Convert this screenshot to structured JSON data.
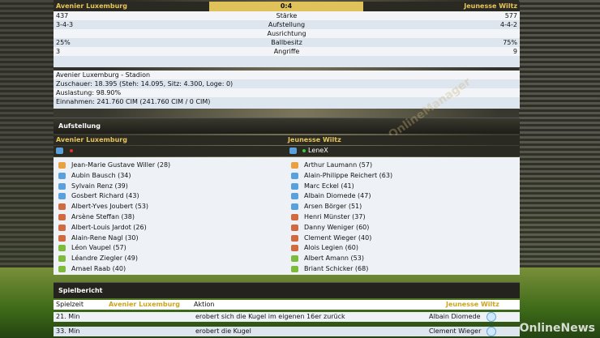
{
  "match": {
    "home": "Avenier Luxemburg",
    "away": "Jeunesse Wiltz",
    "score": "0:4"
  },
  "stats": [
    {
      "home": "437",
      "label": "Stärke",
      "away": "577"
    },
    {
      "home": "3-4-3",
      "label": "Aufstellung",
      "away": "4-4-2"
    },
    {
      "home": "",
      "label": "Ausrichtung",
      "away": ""
    },
    {
      "home": "25%",
      "label": "Ballbesitz",
      "away": "75%"
    },
    {
      "home": "3",
      "label": "Angriffe",
      "away": "9"
    }
  ],
  "info": {
    "stadium": "Avenier Luxemburg - Stadion",
    "spectators": "Zuschauer: 18.395 (Steh: 14.095, Sitz: 4.300, Loge: 0)",
    "utilization": "Auslastung: 98.90%",
    "income": "Einnahmen: 241.760 CIM (241.760 CIM / 0 CIM)"
  },
  "lineup": {
    "title": "Aufstellung",
    "home_team": "Avenier Luxemburg",
    "away_team": "Jeunesse Wiltz",
    "away_manager": "LeneX",
    "home_players": [
      {
        "name": "Jean-Marie Gustave Willer (28)",
        "pos": "gk"
      },
      {
        "name": "Aubin Bausch (34)",
        "pos": "df"
      },
      {
        "name": "Sylvain Renz (39)",
        "pos": "df"
      },
      {
        "name": "Gosbert Richard (43)",
        "pos": "df"
      },
      {
        "name": "Albert-Yves Joubert (53)",
        "pos": "mf"
      },
      {
        "name": "Arsène Steffan (38)",
        "pos": "mf"
      },
      {
        "name": "Albert-Louis Jardot (26)",
        "pos": "mf"
      },
      {
        "name": "Alain-Rene Nagl (30)",
        "pos": "mf"
      },
      {
        "name": "Léon Vaupel (57)",
        "pos": "fw"
      },
      {
        "name": "Léandre Ziegler (49)",
        "pos": "fw"
      },
      {
        "name": "Amael Raab (40)",
        "pos": "fw"
      }
    ],
    "away_players": [
      {
        "name": "Arthur Laumann (57)",
        "pos": "gk"
      },
      {
        "name": "Alain-Philippe Reichert (63)",
        "pos": "df"
      },
      {
        "name": "Marc Eckel (41)",
        "pos": "df"
      },
      {
        "name": "Albain Diomede (47)",
        "pos": "df"
      },
      {
        "name": "Arsen Börger (51)",
        "pos": "df"
      },
      {
        "name": "Henri Münster (37)",
        "pos": "mf"
      },
      {
        "name": "Danny Weniger (60)",
        "pos": "mf"
      },
      {
        "name": "Clement Wieger (40)",
        "pos": "mf"
      },
      {
        "name": "Alois Legien (60)",
        "pos": "mf"
      },
      {
        "name": "Albert Amann (53)",
        "pos": "fw"
      },
      {
        "name": "Briant Schicker (68)",
        "pos": "fw"
      }
    ]
  },
  "report": {
    "title": "Spielbericht",
    "col_time": "Spielzeit",
    "col_home": "Avenier Luxemburg",
    "col_action": "Aktion",
    "col_away": "Jeunesse Wiltz",
    "rows": [
      {
        "time": "21. Min",
        "action": "erobert sich die Kugel im eigenen 16er zurück",
        "away": "Albain Diomede"
      },
      {
        "time": "33. Min",
        "action": "erobert die Kugel",
        "away": "Clement Wieger"
      }
    ]
  },
  "watermark": "OnlineNews"
}
